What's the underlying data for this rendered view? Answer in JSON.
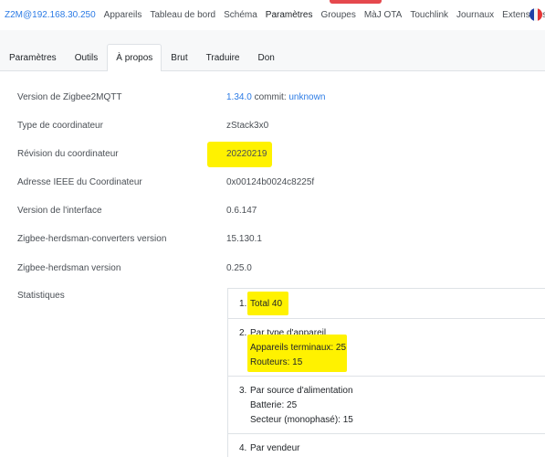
{
  "nav": {
    "brand": "Z2M@192.168.30.250",
    "items": [
      "Appareils",
      "Tableau de bord",
      "Schéma",
      "Paramètres",
      "Groupes",
      "MàJ OTA",
      "Touchlink",
      "Journaux",
      "Extensions"
    ],
    "active": "Paramètres"
  },
  "tabs": {
    "items": [
      "Paramètres",
      "Outils",
      "À propos",
      "Brut",
      "Traduire",
      "Don"
    ],
    "active": "À propos"
  },
  "info": {
    "z2m_version_label": "Version de Zigbee2MQTT",
    "z2m_version": "1.34.0",
    "commit_label": "commit:",
    "commit_value": "unknown",
    "coord_type_label": "Type de coordinateur",
    "coord_type": "zStack3x0",
    "coord_rev_label": "Révision du coordinateur",
    "coord_rev": "20220219",
    "ieee_label": "Adresse IEEE du Coordinateur",
    "ieee": "0x00124b0024c8225f",
    "frontend_label": "Version de l'interface",
    "frontend": "0.6.147",
    "zhc_label": "Zigbee-herdsman-converters version",
    "zhc": "15.130.1",
    "zh_label": "Zigbee-herdsman version",
    "zh": "0.25.0",
    "stats_label": "Statistiques"
  },
  "stats": {
    "total": {
      "num": "1.",
      "text": "Total 40"
    },
    "by_type": {
      "num": "2.",
      "title": "Par type d'appareil",
      "end_devices": "Appareils terminaux: 25",
      "routers": "Routeurs: 15"
    },
    "by_power": {
      "num": "3.",
      "title": "Par source d'alimentation",
      "battery": "Batterie: 25",
      "mains": "Secteur (monophasé): 15"
    },
    "by_vendor": {
      "num": "4.",
      "title": "Par vendeur"
    }
  },
  "colors": {
    "accent": "#2c7be5",
    "highlight": "#fff200",
    "badge": "#e5484d"
  }
}
